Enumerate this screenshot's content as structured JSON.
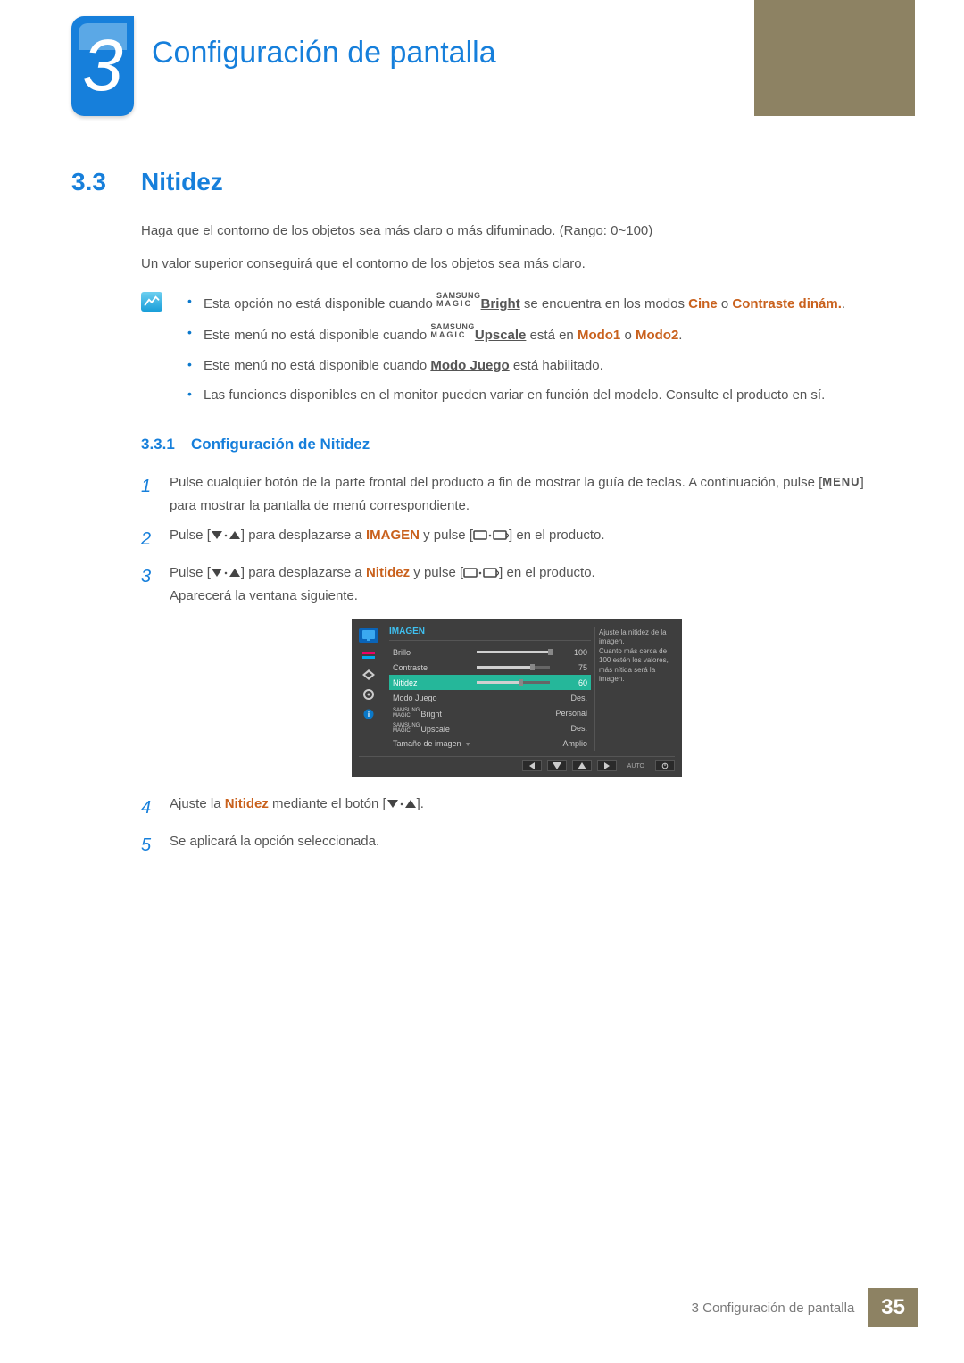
{
  "chapter": {
    "number": "3",
    "title": "Configuración de pantalla"
  },
  "section": {
    "number": "3.3",
    "title": "Nitidez"
  },
  "paragraphs": {
    "p1": "Haga que el contorno de los objetos sea más claro o más difuminado. (Rango: 0~100)",
    "p2": "Un valor superior conseguirá que el contorno de los objetos sea más claro."
  },
  "brand": {
    "top": "SAMSUNG",
    "bot": "MAGIC"
  },
  "notes": {
    "n1_a": "Esta opción no está disponible cuando ",
    "n1_link": "Bright",
    "n1_b": " se encuentra en los modos ",
    "n1_mode1": "Cine",
    "n1_c": " o ",
    "n1_mode2": "Contraste dinám.",
    "n1_d": ".",
    "n2_a": "Este menú no está disponible cuando ",
    "n2_link": "Upscale",
    "n2_b": " está en ",
    "n2_mode1": "Modo1",
    "n2_c": " o ",
    "n2_mode2": "Modo2",
    "n2_d": ".",
    "n3_a": "Este menú no está disponible cuando ",
    "n3_link": "Modo Juego",
    "n3_b": " está habilitado.",
    "n4": "Las funciones disponibles en el monitor pueden variar en función del modelo. Consulte el producto en sí."
  },
  "subsection": {
    "number": "3.3.1",
    "title": "Configuración de Nitidez"
  },
  "steps": {
    "s1": "Pulse cualquier botón de la parte frontal del producto a fin de mostrar la guía de teclas. A continuación, pulse [",
    "s1_btn": "MENU",
    "s1_b": "] para mostrar la pantalla de menú correspondiente.",
    "s2a": "Pulse [",
    "s2b": "] para desplazarse a ",
    "s2_target": "IMAGEN",
    "s2c": " y pulse [",
    "s2d": "] en el producto.",
    "s3a": "Pulse [",
    "s3b": "] para desplazarse a ",
    "s3_target": "Nitidez",
    "s3c": " y pulse [",
    "s3d": "] en el producto.",
    "s3e": "Aparecerá la ventana siguiente.",
    "s4a": "Ajuste la ",
    "s4_target": "Nitidez",
    "s4b": " mediante el botón [",
    "s4c": "].",
    "s5": "Se aplicará la opción seleccionada."
  },
  "osd": {
    "header": "IMAGEN",
    "tip": "Ajuste la nitidez de la imagen.\nCuanto más cerca de 100 estén los valores, más nítida será la imagen.",
    "rows": [
      {
        "label": "Brillo",
        "type": "slider",
        "value": "100",
        "fill": 100
      },
      {
        "label": "Contraste",
        "type": "slider",
        "value": "75",
        "fill": 75
      },
      {
        "label": "Nitidez",
        "type": "slider",
        "value": "60",
        "fill": 60,
        "selected": true
      },
      {
        "label": "Modo Juego",
        "type": "value",
        "value": "Des."
      },
      {
        "label": "Bright",
        "type": "brand",
        "value": "Personal"
      },
      {
        "label": "Upscale",
        "type": "brand",
        "value": "Des."
      },
      {
        "label": "Tamaño de imagen",
        "type": "value",
        "value": "Amplio",
        "arrow": true
      }
    ],
    "auto": "AUTO"
  },
  "footer": {
    "text": "3 Configuración de pantalla",
    "page": "35"
  }
}
